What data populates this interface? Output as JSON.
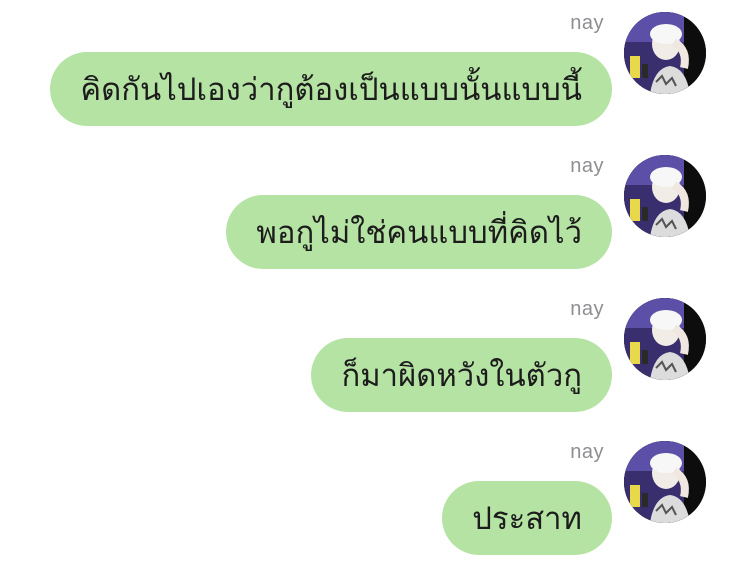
{
  "messages": [
    {
      "sender": "nay",
      "text": "คิดกันไปเองว่ากูต้องเป็นแบบนั้นแบบนี้"
    },
    {
      "sender": "nay",
      "text": "พอกูไม่ใช่คนแบบที่คิดไว้"
    },
    {
      "sender": "nay",
      "text": "ก็มาผิดหวังในตัวกู"
    },
    {
      "sender": "nay",
      "text": "ประสาท"
    }
  ],
  "colors": {
    "bubble": "#b5e3a3",
    "sender_name": "#8e8e93",
    "background": "#ffffff"
  },
  "icons": {
    "avatar": "profile-photo-avatar"
  }
}
